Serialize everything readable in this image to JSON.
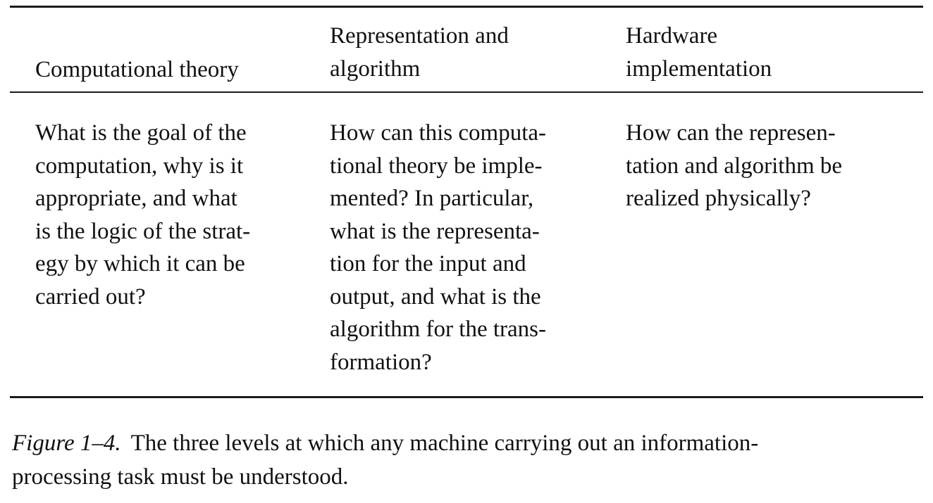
{
  "table": {
    "headers": [
      "Computational theory",
      "Representation and\nalgorithm",
      "Hardware\nimplementation"
    ],
    "cells": [
      "What is the goal of the\ncomputation, why is it\nappropriate, and what\nis the logic of the strat-\negy by which it can be\ncarried out?",
      "How can this computa-\ntional theory be imple-\nmented? In particular,\nwhat is the representa-\ntion for the input and\noutput, and what is the\nalgorithm for the trans-\nformation?",
      "How can the represen-\ntation and algorithm be\nrealized physically?"
    ]
  },
  "caption": {
    "label": "Figure 1–4.",
    "text": "The three levels at which any machine carrying out an information-\nprocessing task must be understood."
  }
}
